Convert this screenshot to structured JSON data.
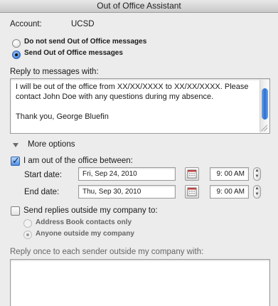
{
  "window": {
    "title": "Out of Office Assistant"
  },
  "account": {
    "label": "Account:",
    "value": "UCSD"
  },
  "oof_mode": {
    "options": [
      {
        "label": "Do not send Out of Office messages",
        "selected": false
      },
      {
        "label": "Send Out of Office messages",
        "selected": true
      }
    ]
  },
  "reply": {
    "label": "Reply to messages with:",
    "paragraphs": [
      "I will be out of the office from XX/XX/XXXX to XX/XX/XXXX. Please contact John Doe with any questions during my absence.",
      "Thank you, George Bluefin"
    ]
  },
  "more_options": {
    "label": "More options",
    "expanded": true
  },
  "schedule": {
    "checkbox_label": "I am out of the office between:",
    "checked": true,
    "start": {
      "label": "Start date:",
      "date": "Fri, Sep 24, 2010",
      "time": "9: 00 AM"
    },
    "end": {
      "label": "End date:",
      "date": "Thu, Sep 30, 2010",
      "time": "9: 00 AM"
    }
  },
  "outside": {
    "checkbox_label": "Send replies outside my company to:",
    "checked": false,
    "options": [
      {
        "label": "Address Book contacts only",
        "selected": false
      },
      {
        "label": "Anyone outside my company",
        "selected": true
      }
    ],
    "reply_label": "Reply once to each sender outside my company with:",
    "reply_text": ""
  },
  "colors": {
    "accent": "#2c6fd1",
    "window_bg": "#ececec",
    "disabled_text": "#666666"
  }
}
